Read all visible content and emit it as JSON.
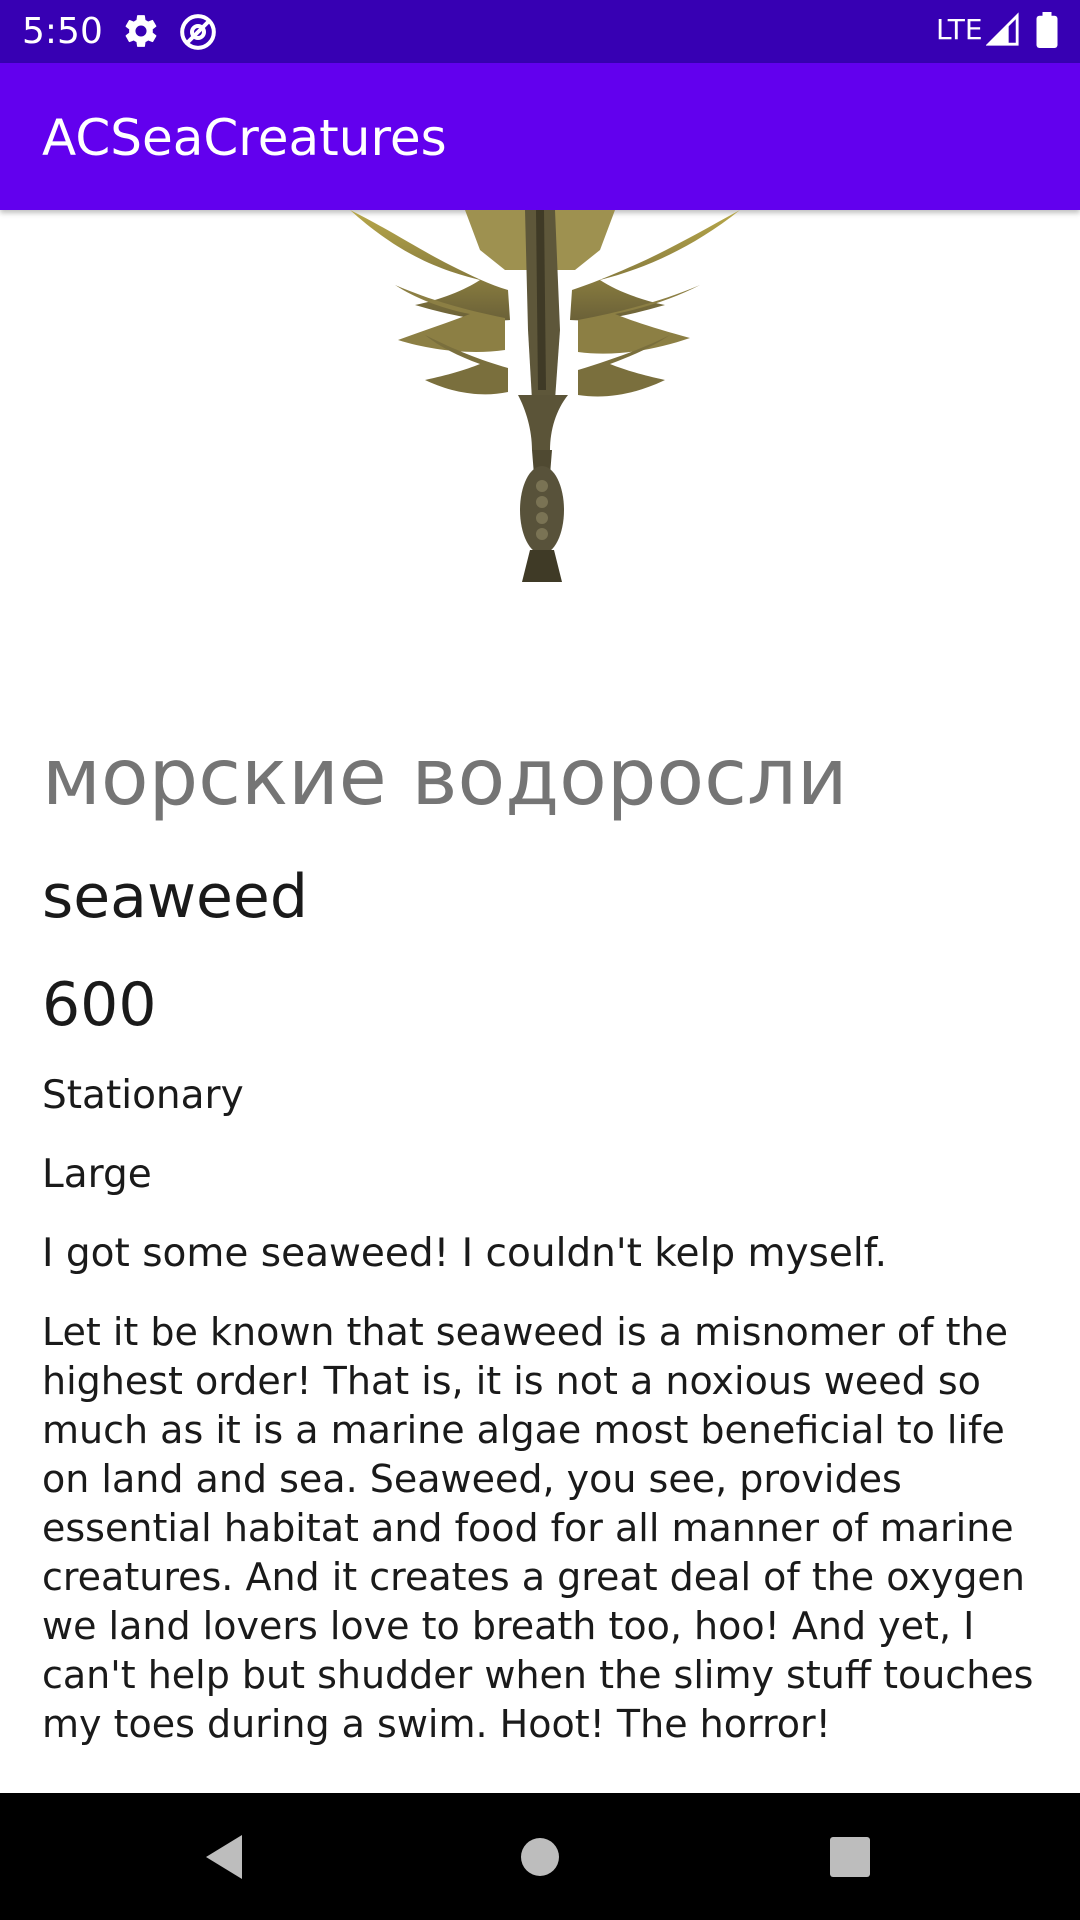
{
  "status_bar": {
    "time": "5:50",
    "network": "LTE",
    "icons": [
      "settings-icon",
      "at-sign-icon",
      "signal-icon",
      "battery-icon"
    ]
  },
  "app_bar": {
    "title": "ACSeaCreatures",
    "color": "#6200ee"
  },
  "creature": {
    "image": "seaweed-image",
    "name_ru": "морские водоросли",
    "name_en": "seaweed",
    "price": "600",
    "shadow": "Stationary",
    "size": "Large",
    "catch_phrase": "I got some seaweed! I couldn't kelp myself.",
    "description": "Let it be known that seaweed is a misnomer of the highest order! That is, it is not a noxious weed so much as it is a marine algae most beneficial to life on land and sea. Seaweed, you see, provides essential habitat and food for all manner of marine creatures. And it creates a great deal of the oxygen we land lovers love to breath too, hoo! And yet, I can't help but shudder when the slimy stuff touches my toes during a swim. Hoot! The horror!"
  },
  "nav_bar": {
    "buttons": [
      "back-icon",
      "home-icon",
      "recents-icon"
    ]
  }
}
